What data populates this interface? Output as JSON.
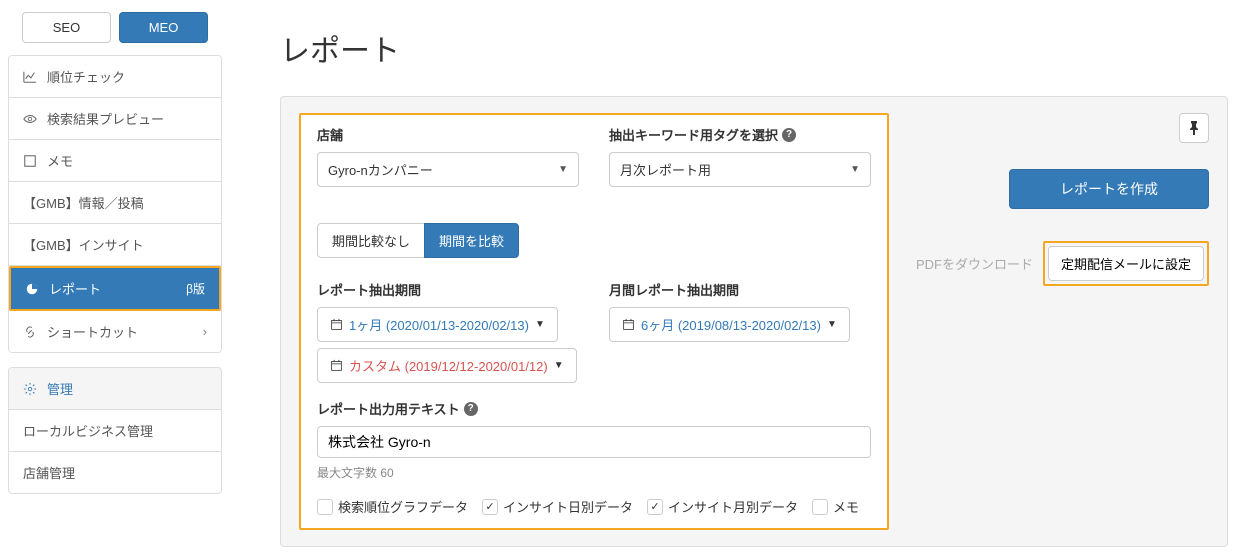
{
  "tabs": {
    "seo": "SEO",
    "meo": "MEO"
  },
  "nav": {
    "rank": "順位チェック",
    "preview": "検索結果プレビュー",
    "memo": "メモ",
    "gmb_post": "【GMB】情報／投稿",
    "gmb_insight": "【GMB】インサイト",
    "report": "レポート",
    "report_beta": "β版",
    "shortcut": "ショートカット"
  },
  "nav2": {
    "admin": "管理",
    "local": "ローカルビジネス管理",
    "store_admin": "店舗管理"
  },
  "page_title": "レポート",
  "form": {
    "store_label": "店舗",
    "store_value": "Gyro-nカンパニー",
    "tag_label": "抽出キーワード用タグを選択",
    "tag_value": "月次レポート用",
    "compare_off": "期間比較なし",
    "compare_on": "期間を比較",
    "period_label": "レポート抽出期間",
    "period_value": "1ヶ月 (2020/01/13-2020/02/13)",
    "custom_value": "カスタム (2019/12/12-2020/01/12)",
    "monthly_label": "月間レポート抽出期間",
    "monthly_value": "6ヶ月 (2019/08/13-2020/02/13)",
    "text_label": "レポート出力用テキスト",
    "text_value": "株式会社 Gyro-n",
    "text_hint": "最大文字数 60",
    "cb_rank": "検索順位グラフデータ",
    "cb_daily": "インサイト日別データ",
    "cb_monthly": "インサイト月別データ",
    "cb_memo": "メモ"
  },
  "actions": {
    "create": "レポートを作成",
    "pdf": "PDFをダウンロード",
    "schedule": "定期配信メールに設定"
  }
}
